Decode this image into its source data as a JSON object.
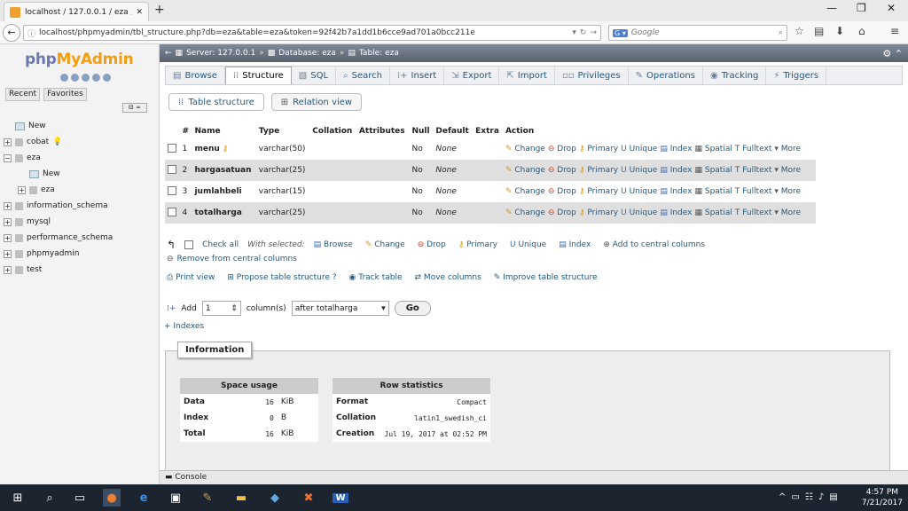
{
  "browser": {
    "tab_title": "localhost / 127.0.0.1 / eza / eza...",
    "url": "localhost/phpmyadmin/tbl_structure.php?db=eza&table=eza&token=92f42b7a1dd1b6cce9ad701a0bcc211e",
    "search_placeholder": "Google",
    "new_tab": "+",
    "minimize": "—",
    "maximize": "❐",
    "close": "✕"
  },
  "sidebar": {
    "logo_php": "php",
    "logo_myadmin": "MyAdmin",
    "recent": "Recent",
    "favorites": "Favorites",
    "tree": [
      {
        "label": "New",
        "level": 0,
        "type": "new"
      },
      {
        "label": "cobat",
        "level": 0,
        "type": "db"
      },
      {
        "label": "eza",
        "level": 0,
        "type": "db"
      },
      {
        "label": "New",
        "level": 1,
        "type": "new"
      },
      {
        "label": "eza",
        "level": 1,
        "type": "table"
      },
      {
        "label": "information_schema",
        "level": 0,
        "type": "db"
      },
      {
        "label": "mysql",
        "level": 0,
        "type": "db"
      },
      {
        "label": "performance_schema",
        "level": 0,
        "type": "db"
      },
      {
        "label": "phpmyadmin",
        "level": 0,
        "type": "db"
      },
      {
        "label": "test",
        "level": 0,
        "type": "db"
      }
    ]
  },
  "breadcrumb": {
    "server": "Server: 127.0.0.1",
    "database": "Database: eza",
    "table": "Table: eza"
  },
  "menu": {
    "items": [
      {
        "label": "Browse",
        "icon": "browse-icon"
      },
      {
        "label": "Structure",
        "icon": "structure-icon",
        "active": true
      },
      {
        "label": "SQL",
        "icon": "sql-icon"
      },
      {
        "label": "Search",
        "icon": "search-icon"
      },
      {
        "label": "Insert",
        "icon": "insert-icon"
      },
      {
        "label": "Export",
        "icon": "export-icon"
      },
      {
        "label": "Import",
        "icon": "import-icon"
      },
      {
        "label": "Privileges",
        "icon": "privileges-icon"
      },
      {
        "label": "Operations",
        "icon": "operations-icon"
      },
      {
        "label": "Tracking",
        "icon": "tracking-icon"
      },
      {
        "label": "Triggers",
        "icon": "triggers-icon"
      }
    ]
  },
  "subtabs": {
    "table_structure": "Table structure",
    "relation_view": "Relation view"
  },
  "columns": {
    "headers": [
      "#",
      "Name",
      "Type",
      "Collation",
      "Attributes",
      "Null",
      "Default",
      "Extra",
      "Action"
    ],
    "rows": [
      {
        "num": "1",
        "name": "menu",
        "type": "varchar(50)",
        "null": "No",
        "default": "None",
        "key": true
      },
      {
        "num": "2",
        "name": "hargasatuan",
        "type": "varchar(25)",
        "null": "No",
        "default": "None",
        "key": false
      },
      {
        "num": "3",
        "name": "jumlahbeli",
        "type": "varchar(15)",
        "null": "No",
        "default": "None",
        "key": false
      },
      {
        "num": "4",
        "name": "totalharga",
        "type": "varchar(25)",
        "null": "No",
        "default": "None",
        "key": false
      }
    ],
    "actions": [
      "Change",
      "Drop",
      "Primary",
      "Unique",
      "Index",
      "Spatial",
      "Fulltext",
      "More"
    ]
  },
  "with_selected": {
    "check_all": "Check all",
    "label": "With selected:",
    "actions": [
      "Browse",
      "Change",
      "Drop",
      "Primary",
      "Unique",
      "Index",
      "Add to central columns"
    ],
    "remove": "Remove from central columns"
  },
  "tools": {
    "print_view": "Print view",
    "propose": "Propose table structure",
    "track": "Track table",
    "move": "Move columns",
    "improve": "Improve table structure"
  },
  "add_column": {
    "label": "Add",
    "count": "1",
    "unit": "column(s)",
    "position": "after totalharga",
    "go": "Go",
    "indexes": "+ Indexes"
  },
  "information": {
    "legend": "Information",
    "space_usage": {
      "title": "Space usage",
      "rows": [
        {
          "label": "Data",
          "value": "16",
          "unit": "KiB"
        },
        {
          "label": "Index",
          "value": "0",
          "unit": "B"
        },
        {
          "label": "Total",
          "value": "16",
          "unit": "KiB"
        }
      ]
    },
    "row_statistics": {
      "title": "Row statistics",
      "rows": [
        {
          "label": "Format",
          "value": "Compact"
        },
        {
          "label": "Collation",
          "value": "latin1_swedish_ci"
        },
        {
          "label": "Creation",
          "value": "Jul 19, 2017 at 02:52 PM"
        }
      ]
    }
  },
  "console": "Console",
  "taskbar": {
    "time": "4:57 PM",
    "date": "7/21/2017"
  }
}
